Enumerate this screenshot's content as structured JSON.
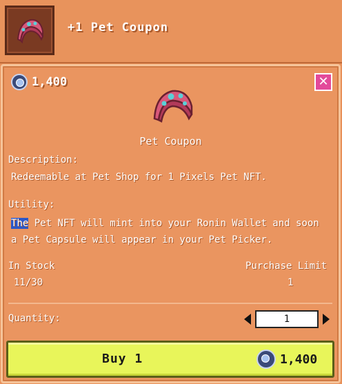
{
  "header": {
    "title": "+1 Pet Coupon",
    "thumbnail_icon": "pet-coupon-icon"
  },
  "panel": {
    "price": "1,400",
    "currency_icon": "pixel-coin-icon",
    "close_icon": "close-icon",
    "item_name": "Pet Coupon",
    "description_label": "Description:",
    "description_text": "Redeemable at Pet Shop for 1 Pixels Pet NFT.",
    "utility_label": "Utility:",
    "utility_highlight": "The",
    "utility_line1_rest": " Pet NFT will mint into your Ronin Wallet and soon",
    "utility_line2": "a Pet Capsule will appear in your Pet Picker.",
    "in_stock_label": "In Stock",
    "in_stock_value": "11/30",
    "purchase_limit_label": "Purchase Limit",
    "purchase_limit_value": "1",
    "quantity_label": "Quantity:",
    "quantity_value": "1"
  },
  "buy_button": {
    "label": "Buy 1",
    "price": "1,400"
  },
  "colors": {
    "panel_bg": "#ea9560",
    "buy_bg": "#e8f55a",
    "close_bg": "#e34a9a",
    "highlight": "#2c58c8"
  }
}
